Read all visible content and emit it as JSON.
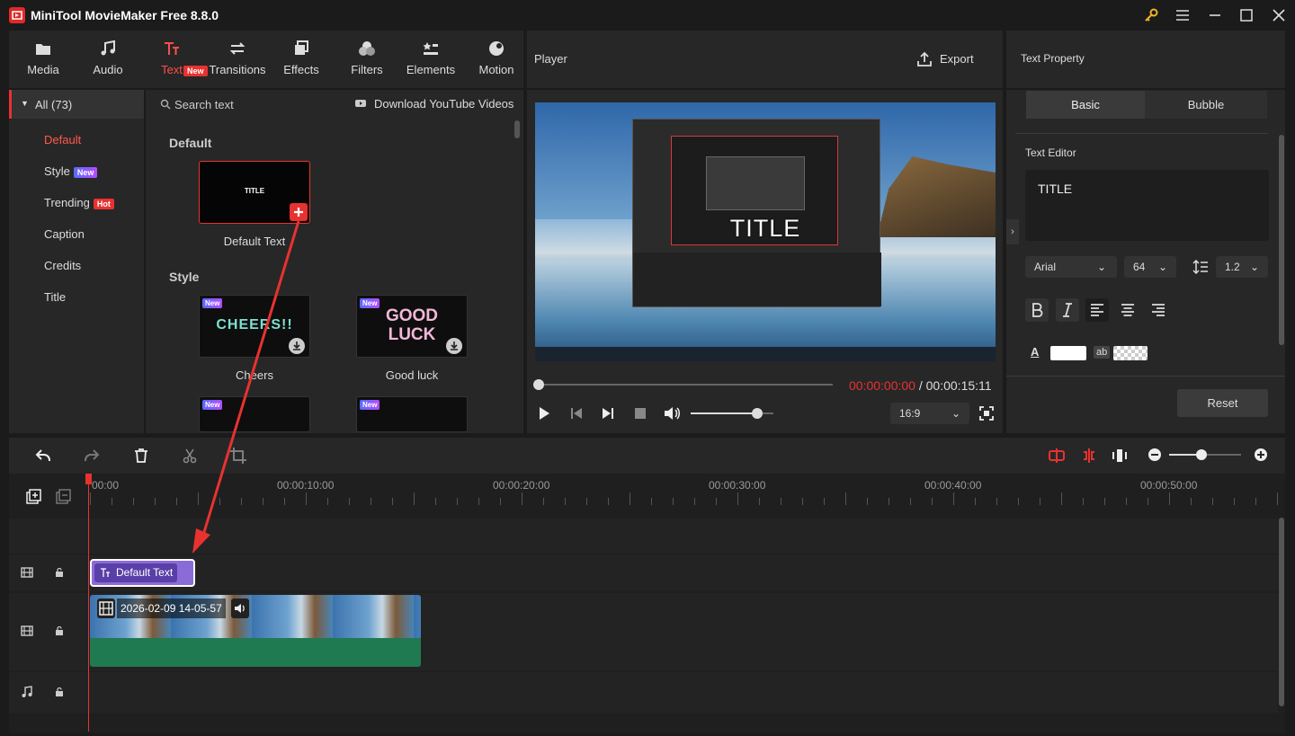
{
  "app": {
    "title": "MiniTool MovieMaker Free 8.8.0"
  },
  "toolbar": {
    "items": [
      {
        "label": "Media",
        "icon": "media-icon"
      },
      {
        "label": "Audio",
        "icon": "audio-icon"
      },
      {
        "label": "Text",
        "icon": "text-icon",
        "active": true
      },
      {
        "label": "Transitions",
        "icon": "transitions-icon"
      },
      {
        "label": "Effects",
        "icon": "effects-icon"
      },
      {
        "label": "Filters",
        "icon": "filters-icon"
      },
      {
        "label": "Elements",
        "icon": "elements-icon"
      },
      {
        "label": "Motion",
        "icon": "motion-icon"
      }
    ],
    "new_badge": "New"
  },
  "categories": {
    "header": "All (73)",
    "items": [
      {
        "label": "Default",
        "active": true
      },
      {
        "label": "Style",
        "badge": "New"
      },
      {
        "label": "Trending",
        "badge": "Hot"
      },
      {
        "label": "Caption"
      },
      {
        "label": "Credits"
      },
      {
        "label": "Title"
      }
    ]
  },
  "gallery": {
    "search_placeholder": "Search text",
    "download_link": "Download YouTube Videos",
    "section_default": "Default",
    "section_style": "Style",
    "default_item": {
      "thumb_text": "TITLE",
      "label": "Default Text"
    },
    "style_items": [
      {
        "label": "Cheers",
        "art": "CHEERS!!",
        "tag": "New"
      },
      {
        "label": "Good luck",
        "art1": "GOOD",
        "art2": "LUCK",
        "tag": "New"
      }
    ],
    "more_tags": [
      "New",
      "New"
    ]
  },
  "player": {
    "title": "Player",
    "export_label": "Export",
    "overlay_title": "TITLE",
    "current_time": "00:00:00:00",
    "separator": " / ",
    "total_time": "00:00:15:11",
    "aspect": "16:9",
    "volume_fraction": 0.8
  },
  "property": {
    "title": "Text Property",
    "tabs": [
      "Basic",
      "Bubble"
    ],
    "editor_label": "Text Editor",
    "editor_value": "TITLE",
    "font": "Arial",
    "size": "64",
    "line_spacing": "1.2",
    "color_label": "A",
    "bg_label": "ab",
    "reset_label": "Reset"
  },
  "timeline": {
    "ticks": [
      "00:00",
      "00:00:10:00",
      "00:00:20:00",
      "00:00:30:00",
      "00:00:40:00",
      "00:00:50:00"
    ],
    "text_clip": "Default Text",
    "video_clip": "2026-02-09 14-05-57",
    "zoom_fraction": 0.45
  },
  "colors": {
    "accent": "#e8322f",
    "text_clip": "#8a6bd8",
    "audio_wave": "#1f7a52"
  }
}
